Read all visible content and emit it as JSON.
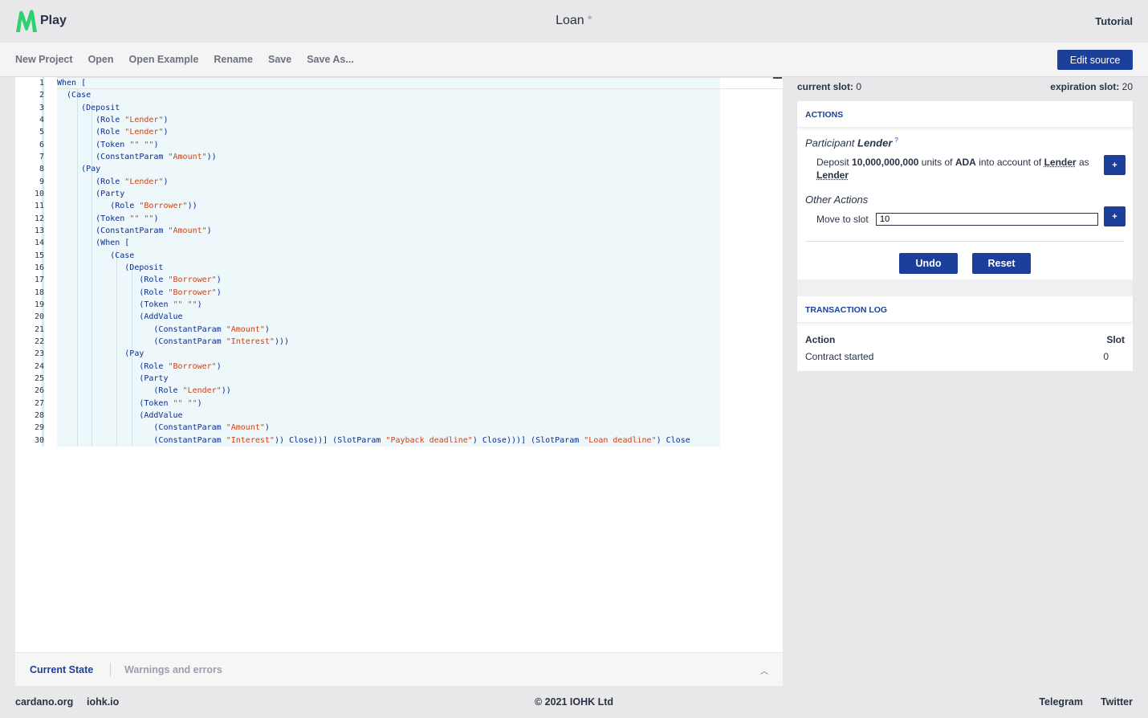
{
  "app": {
    "logo_text": "Play",
    "project_title": "Loan",
    "unsaved_marker": "*",
    "tutorial_label": "Tutorial"
  },
  "menu": {
    "new_project": "New Project",
    "open": "Open",
    "open_example": "Open Example",
    "rename": "Rename",
    "save": "Save",
    "save_as": "Save As...",
    "edit_source": "Edit source"
  },
  "editor": {
    "line_numbers": [
      "1",
      "2",
      "3",
      "4",
      "5",
      "6",
      "7",
      "8",
      "9",
      "10",
      "11",
      "12",
      "13",
      "14",
      "15",
      "16",
      "17",
      "18",
      "19",
      "20",
      "21",
      "22",
      "23",
      "24",
      "25",
      "26",
      "27",
      "28",
      "29",
      "30"
    ],
    "lines": [
      "When [",
      "  (Case",
      "     (Deposit",
      "        (Role \"Lender\")",
      "        (Role \"Lender\")",
      "        (Token \"\" \"\")",
      "        (ConstantParam \"Amount\"))",
      "     (Pay",
      "        (Role \"Lender\")",
      "        (Party",
      "           (Role \"Borrower\"))",
      "        (Token \"\" \"\")",
      "        (ConstantParam \"Amount\")",
      "        (When [",
      "           (Case",
      "              (Deposit",
      "                 (Role \"Borrower\")",
      "                 (Role \"Borrower\")",
      "                 (Token \"\" \"\")",
      "                 (AddValue",
      "                    (ConstantParam \"Amount\")",
      "                    (ConstantParam \"Interest\")))",
      "              (Pay",
      "                 (Role \"Borrower\")",
      "                 (Party",
      "                    (Role \"Lender\"))",
      "                 (Token \"\" \"\")",
      "                 (AddValue",
      "                    (ConstantParam \"Amount\")",
      "                    (ConstantParam \"Interest\")) Close))] (SlotParam \"Payback deadline\") Close)))] (SlotParam \"Loan deadline\") Close"
    ]
  },
  "bottom_tabs": {
    "current_state": "Current State",
    "warnings": "Warnings and errors"
  },
  "simulation": {
    "current_slot_label": "current slot:",
    "current_slot": "0",
    "expiration_slot_label": "expiration slot:",
    "expiration_slot": "20",
    "actions_title": "ACTIONS",
    "participant_prefix": "Participant",
    "participant_name": "Lender",
    "deposit": {
      "w1": "Deposit",
      "amount": "10,000,000,000",
      "w2": "units of",
      "token": "ADA",
      "w3": "into account of",
      "account": "Lender",
      "w4": "as",
      "party": "Lender"
    },
    "plus_label": "+",
    "other_actions": "Other Actions",
    "move_to_slot_label": "Move to slot",
    "move_to_slot_value": "10",
    "undo": "Undo",
    "reset": "Reset",
    "log_title": "TRANSACTION LOG",
    "log_col_action": "Action",
    "log_col_slot": "Slot",
    "log_rows": [
      {
        "action": "Contract started",
        "slot": "0"
      }
    ]
  },
  "footer": {
    "cardano": "cardano.org",
    "iohk": "iohk.io",
    "copyright": "© 2021 IOHK Ltd",
    "telegram": "Telegram",
    "twitter": "Twitter"
  },
  "colors": {
    "accent": "#1c3f9c",
    "logo_green": "#2ed16e",
    "string": "#c9461d",
    "keyword": "#0c2e8e"
  }
}
